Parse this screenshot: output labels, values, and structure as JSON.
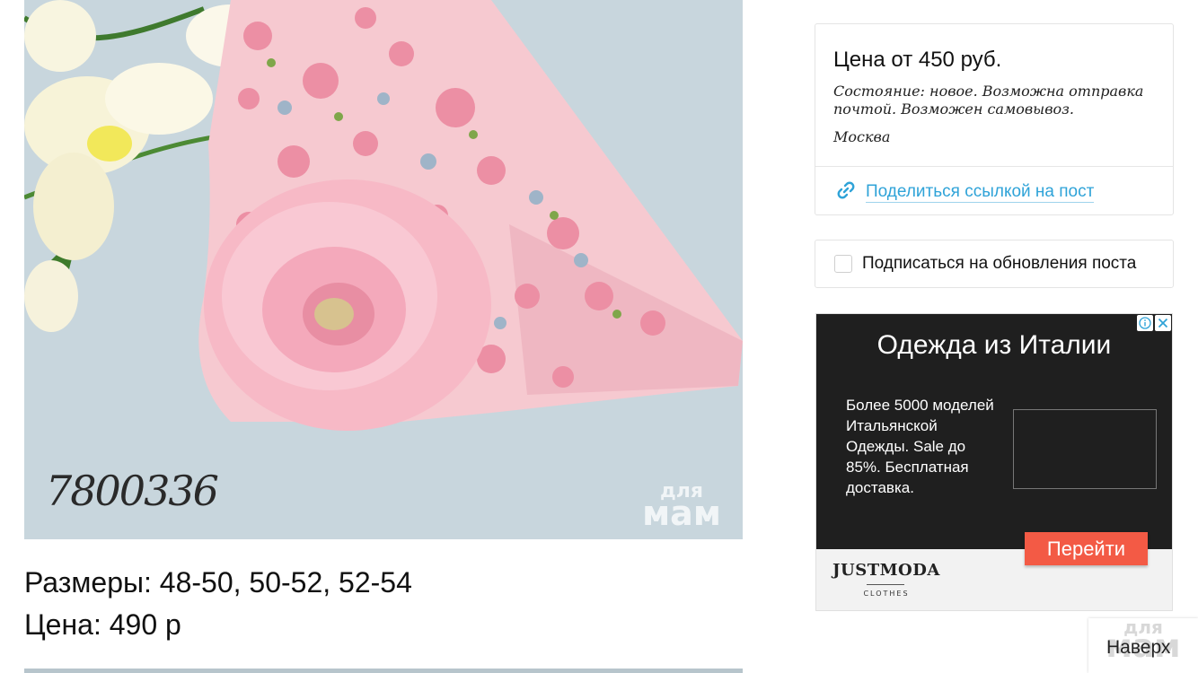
{
  "product": {
    "image_code": "7800336",
    "watermark_top": "для",
    "watermark_bottom": "мам",
    "sizes": "Размеры: 48-50, 50-52, 52-54",
    "price": "Цена: 490 р"
  },
  "sidebar": {
    "price": "Цена от 450 руб.",
    "condition": "Состояние: новое. Возможна отправка почтой. Возможен самовывоз.",
    "city": "Москва",
    "share_label": "Поделиться ссылкой на пост",
    "share_icon": "link-icon",
    "subscribe_label": "Подписаться на обновления поста"
  },
  "ad": {
    "title": "Одежда из Италии",
    "description": "Более 5000 моделей Итальянской Одежды. Sale до 85%. Бесплатная доставка.",
    "button": "Перейти",
    "brand": "JUSTMODA",
    "brand_sub": "CLOTHES"
  },
  "back_to_top": {
    "label": "Наверх",
    "watermark_top": "для",
    "watermark_bottom": "мам"
  },
  "colors": {
    "link": "#2fa3d8",
    "ad_button": "#f35a45",
    "ad_background": "#1f1f1f"
  }
}
